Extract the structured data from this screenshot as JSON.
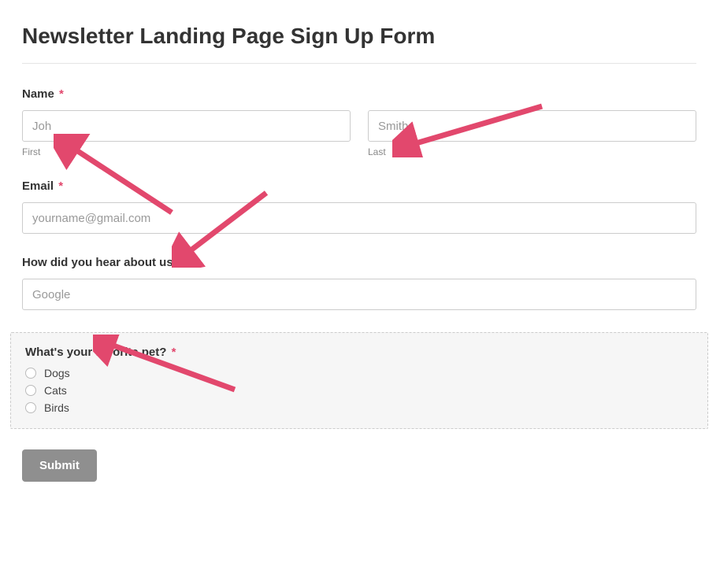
{
  "title": "Newsletter Landing Page Sign Up Form",
  "name": {
    "label": "Name",
    "first_placeholder": "Joh",
    "first_sublabel": "First",
    "last_placeholder": "Smith",
    "last_sublabel": "Last"
  },
  "email": {
    "label": "Email",
    "placeholder": "yourname@gmail.com"
  },
  "hear": {
    "label": "How did you hear about us?",
    "placeholder": "Google"
  },
  "pet": {
    "label": "What's your favorite pet?",
    "options": [
      "Dogs",
      "Cats",
      "Birds"
    ]
  },
  "submit_label": "Submit",
  "required_mark": "*",
  "arrow_color": "#e2486d"
}
